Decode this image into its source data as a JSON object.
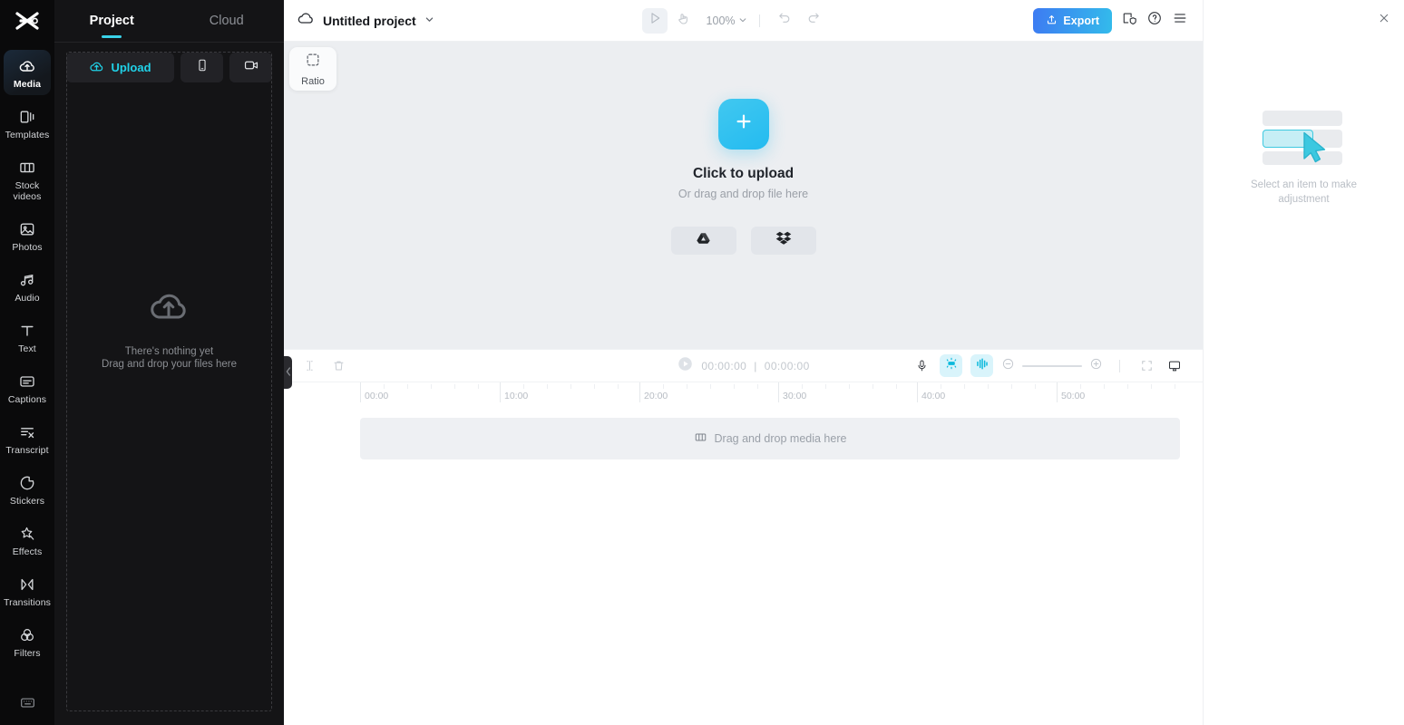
{
  "app": {
    "logo_icon": "capcut-logo"
  },
  "rail": {
    "items": [
      {
        "label": "Media",
        "icon": "cloud-upload-icon",
        "active": true
      },
      {
        "label": "Templates",
        "icon": "templates-icon",
        "active": false
      },
      {
        "label": "Stock videos",
        "icon": "film-strip-icon",
        "active": false
      },
      {
        "label": "Photos",
        "icon": "photo-icon",
        "active": false
      },
      {
        "label": "Audio",
        "icon": "music-note-icon",
        "active": false
      },
      {
        "label": "Text",
        "icon": "text-t-icon",
        "active": false
      },
      {
        "label": "Captions",
        "icon": "captions-icon",
        "active": false
      },
      {
        "label": "Transcript",
        "icon": "transcript-icon",
        "active": false
      },
      {
        "label": "Stickers",
        "icon": "sticker-icon",
        "active": false
      },
      {
        "label": "Effects",
        "icon": "sparkle-icon",
        "active": false
      },
      {
        "label": "Transitions",
        "icon": "transitions-icon",
        "active": false
      },
      {
        "label": "Filters",
        "icon": "filters-icon",
        "active": false
      }
    ],
    "bottom_icon": "keyboard-shortcuts-icon"
  },
  "panel": {
    "tabs": [
      {
        "label": "Project",
        "active": true
      },
      {
        "label": "Cloud",
        "active": false
      }
    ],
    "upload_label": "Upload",
    "upload_icon": "cloud-upload-icon",
    "phone_icon": "phone-icon",
    "camera_icon": "camera-icon",
    "empty_icon": "cloud-upload-icon",
    "empty_line1": "There's nothing yet",
    "empty_line2": "Drag and drop your files here",
    "collapse_icon": "chevron-left-icon"
  },
  "header": {
    "cloud_icon": "cloud-icon",
    "project_title": "Untitled project",
    "title_chevron_icon": "chevron-down-icon",
    "play_mode_icon": "cursor-play-icon",
    "hand_icon": "hand-icon",
    "zoom_level": "100%",
    "zoom_chevron_icon": "chevron-down-icon",
    "undo_icon": "undo-icon",
    "redo_icon": "redo-icon",
    "export_label": "Export",
    "export_icon": "export-upload-icon",
    "export_gradient_from": "#3d7bf2",
    "export_gradient_to": "#33bbeb",
    "backup_icon": "shield-backup-icon",
    "help_icon": "help-circle-icon",
    "menu_icon": "hamburger-menu-icon"
  },
  "canvas": {
    "ratio_label": "Ratio",
    "ratio_icon": "dashed-square-icon",
    "plus_icon": "plus-icon",
    "upload_title": "Click to upload",
    "upload_subtitle": "Or drag and drop file here",
    "accent_color": "#28bbee",
    "cloud_sources": [
      {
        "name": "google-drive-icon"
      },
      {
        "name": "dropbox-icon"
      }
    ]
  },
  "timeline": {
    "split_icon": "split-clip-icon",
    "delete_icon": "trash-icon",
    "play_icon": "play-circle-icon",
    "current_time": "00:00:00",
    "time_divider": "|",
    "total_time": "00:00:00",
    "mic_icon": "microphone-icon",
    "autocut_icon": "auto-cut-icon",
    "audio_split_icon": "audio-waveform-icon",
    "zoom_out_icon": "zoom-out-icon",
    "zoom_in_icon": "zoom-in-icon",
    "fit_icon": "fit-to-screen-icon",
    "preview_icon": "monitor-icon",
    "ruler_labels": [
      "00:00",
      "10:00",
      "20:00",
      "30:00",
      "40:00",
      "50:00"
    ],
    "track_placeholder": "Drag and drop media here",
    "track_icon": "film-strip-icon"
  },
  "right_panel": {
    "close_icon": "close-icon",
    "empty_text": "Select an item to make adjustment",
    "illustration_icon": "cursor-select-illustration"
  }
}
